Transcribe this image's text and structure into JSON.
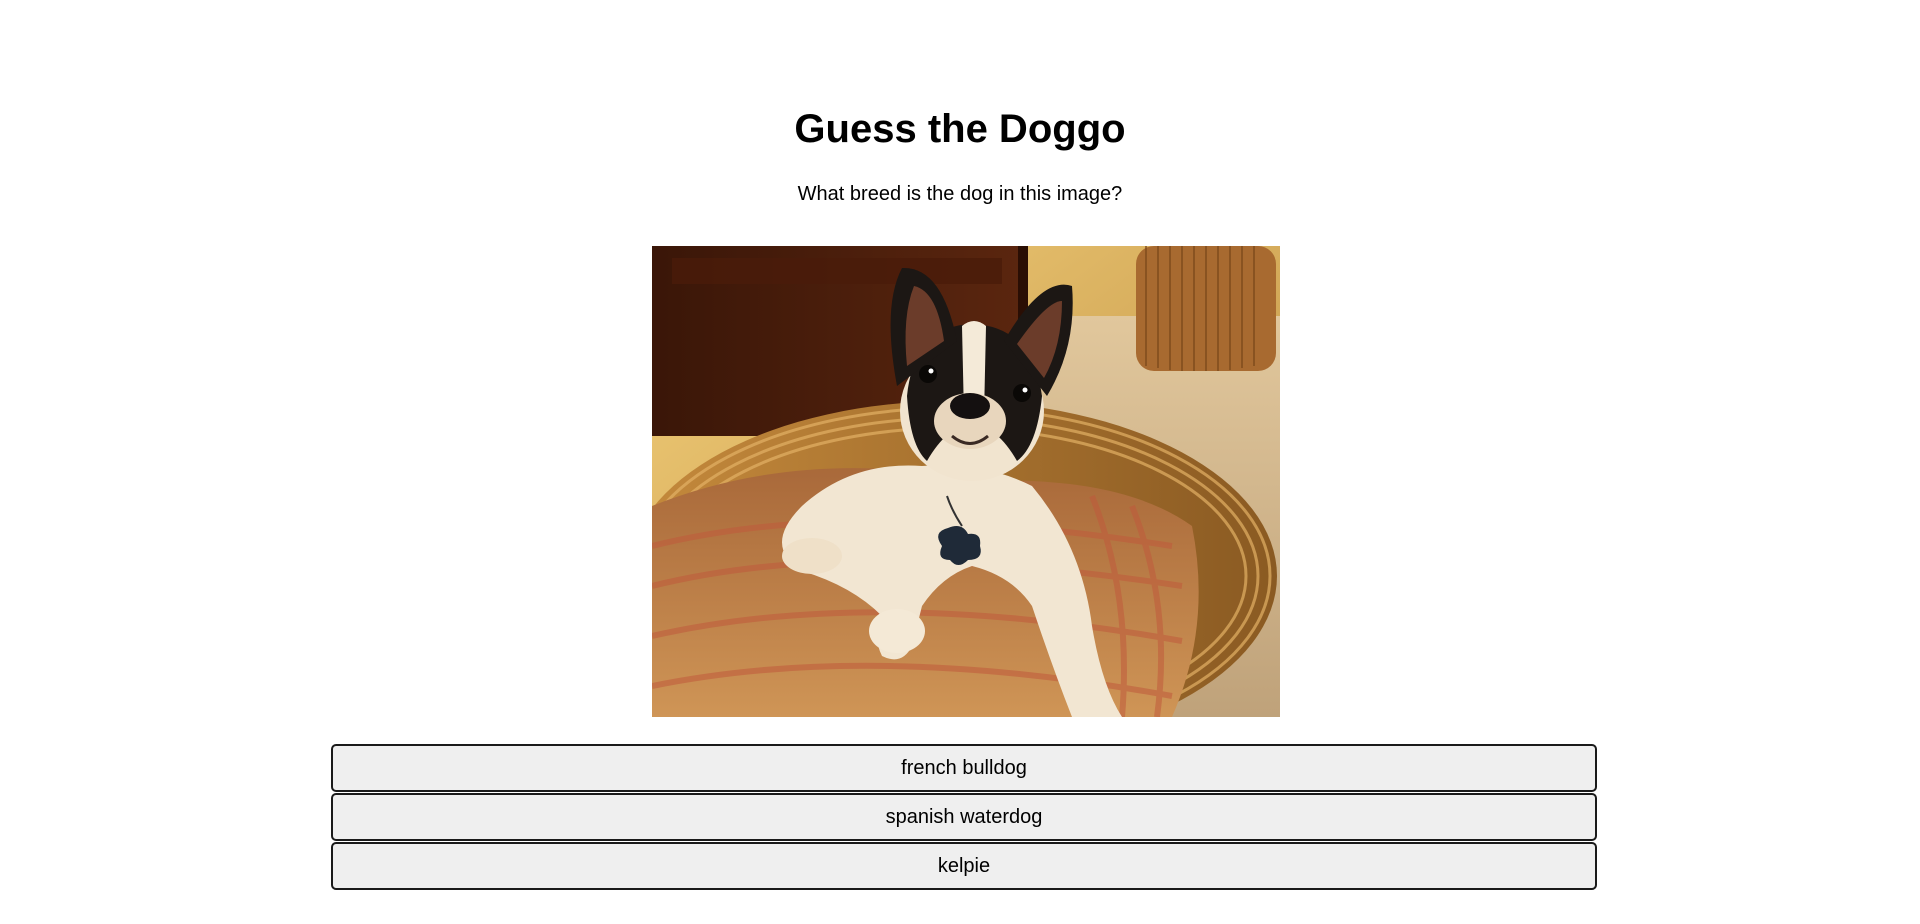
{
  "page": {
    "title": "Guess the Doggo",
    "question": "What breed is the dog in this image?"
  },
  "answers": [
    {
      "label": "french bulldog"
    },
    {
      "label": "spanish waterdog"
    },
    {
      "label": "kelpie"
    }
  ]
}
